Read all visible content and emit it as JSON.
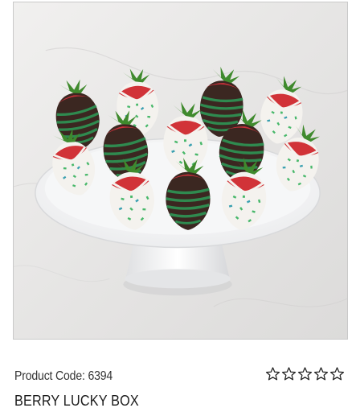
{
  "product": {
    "code_label": "Product Code: 6394",
    "title": "BERRY LUCKY BOX",
    "rating": {
      "filled": 0,
      "total": 5
    },
    "image": {
      "icon": "product-photo",
      "description_colors": {
        "marble": "#eceaea",
        "chocolate": "#3c2a23",
        "green_stripe": "#2f8a4f",
        "white_chocolate": "#f3f1ec",
        "sprinkle": "#48b86a",
        "strawberry": "#d2343a",
        "leaf": "#3e8a2e"
      }
    }
  }
}
